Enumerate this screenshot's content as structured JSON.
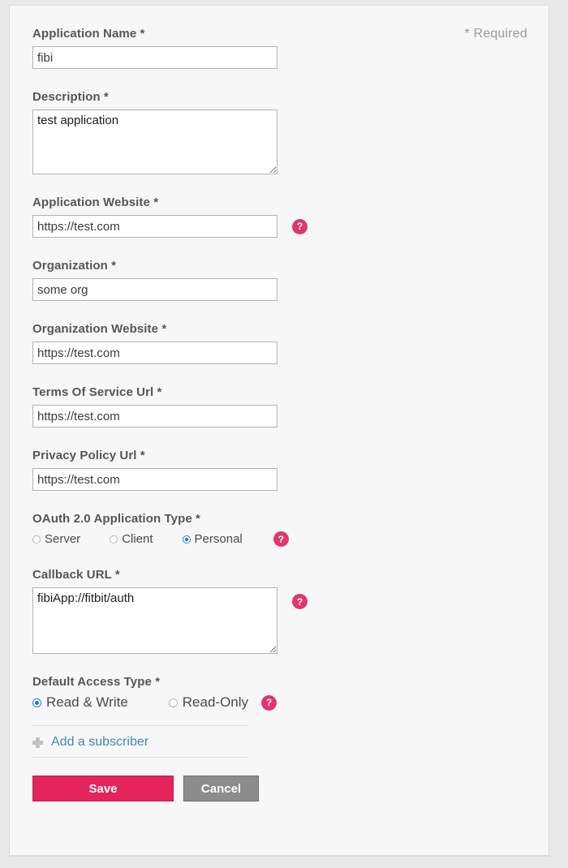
{
  "panel": {
    "required_note": "* Required"
  },
  "form": {
    "fields": [
      {
        "label": "Application Name *",
        "value": "fibi",
        "type": "text"
      },
      {
        "label": "Description *",
        "value": "test application",
        "type": "textarea"
      },
      {
        "label": "Application Website *",
        "value": "https://test.com",
        "type": "text",
        "help": "?"
      },
      {
        "label": "Organization *",
        "value": "some org",
        "type": "text"
      },
      {
        "label": "Organization Website *",
        "value": "https://test.com",
        "type": "text"
      },
      {
        "label": "Terms Of Service Url *",
        "value": "https://test.com",
        "type": "text"
      },
      {
        "label": "Privacy Policy Url *",
        "value": "https://test.com",
        "type": "text"
      }
    ],
    "app_name": {
      "label": "Application Name *",
      "value": "fibi"
    },
    "description": {
      "label": "Description *",
      "value": "test application"
    },
    "app_website": {
      "label": "Application Website *",
      "value": "https://test.com"
    },
    "organization": {
      "label": "Organization *",
      "value": "some org"
    },
    "org_website": {
      "label": "Organization Website *",
      "value": "https://test.com"
    },
    "tos_url": {
      "label": "Terms Of Service Url *",
      "value": "https://test.com"
    },
    "privacy_url": {
      "label": "Privacy Policy Url *",
      "value": "https://test.com"
    },
    "oauth_type": {
      "label": "OAuth 2.0 Application Type *",
      "options": [
        {
          "label": "Server",
          "selected": false
        },
        {
          "label": "Client",
          "selected": false
        },
        {
          "label": "Personal",
          "selected": true
        }
      ],
      "selected": "Personal"
    },
    "callback_url": {
      "label": "Callback URL *",
      "value": "fibiApp://fitbit/auth"
    },
    "access_type": {
      "label": "Default Access Type *",
      "options": [
        {
          "label": "Read & Write",
          "selected": true
        },
        {
          "label": "Read-Only",
          "selected": false
        }
      ],
      "selected": "Read & Write"
    },
    "subscriber": {
      "label": "Add a subscriber",
      "icon": "plus-icon"
    },
    "help_icon_glyph": "?",
    "actions": {
      "save_label": "Save",
      "cancel_label": "Cancel"
    }
  },
  "colors": {
    "accent_pink": "#e5245c",
    "help_badge": "#e0366b",
    "link_blue": "#4287ae",
    "radio_selected": "#1874e8",
    "cancel_gray": "#8c8c8c",
    "label_gray": "#565656",
    "panel_bg": "#f7f7f7",
    "page_bg": "#e9e9e9"
  }
}
